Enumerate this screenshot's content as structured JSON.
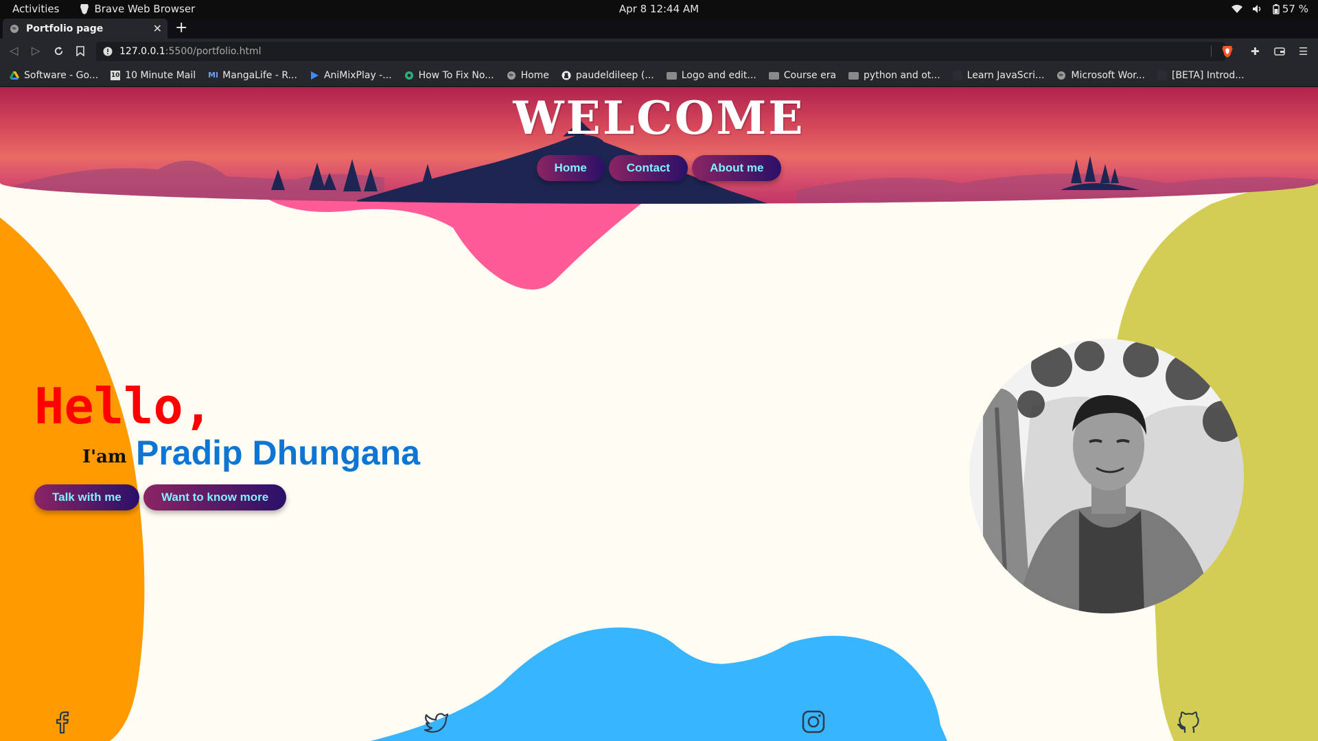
{
  "system_bar": {
    "activities": "Activities",
    "app_name": "Brave Web Browser",
    "datetime": "Apr 8  12:44 AM",
    "battery": "57 %"
  },
  "browser": {
    "tab_title": "Portfolio page",
    "url_host": "127.0.0.1",
    "url_path": ":5500/portfolio.html",
    "bookmarks": [
      {
        "label": "Software - Go...",
        "icon": "google-drive-icon"
      },
      {
        "label": "10 Minute Mail",
        "icon": "ten-minute-mail-icon"
      },
      {
        "label": "MangaLife - R...",
        "icon": "mangalife-icon"
      },
      {
        "label": "AniMixPlay -...",
        "icon": "animixplay-icon"
      },
      {
        "label": "How To Fix No...",
        "icon": "site-icon"
      },
      {
        "label": "Home",
        "icon": "globe-icon"
      },
      {
        "label": "paudeldileep (...",
        "icon": "github-icon"
      },
      {
        "label": "Logo and edit...",
        "icon": "folder-icon"
      },
      {
        "label": "Course era",
        "icon": "folder-icon"
      },
      {
        "label": "python and ot...",
        "icon": "folder-icon"
      },
      {
        "label": "Learn JavaScri...",
        "icon": "site-icon"
      },
      {
        "label": "Microsoft Wor...",
        "icon": "globe-icon"
      },
      {
        "label": "[BETA] Introd...",
        "icon": "site-icon"
      }
    ]
  },
  "page": {
    "title": "WELCOME",
    "nav": [
      "Home",
      "Contact",
      "About me"
    ],
    "greeting": "Hello,",
    "iam": "I'am",
    "name": "Pradip Dhungana",
    "cta_talk": "Talk with me",
    "cta_more": "Want to know more",
    "social": [
      "facebook-icon",
      "twitter-icon",
      "instagram-icon",
      "github-icon"
    ],
    "colors": {
      "greeting": "#ff0000",
      "name": "#0d75d4",
      "pill_text": "#7ff2ff",
      "blob_orange": "#ff9a00",
      "blob_olive": "#d3cc55",
      "blob_blue": "#38b5ff",
      "blob_pink": "#ff5b97"
    }
  }
}
